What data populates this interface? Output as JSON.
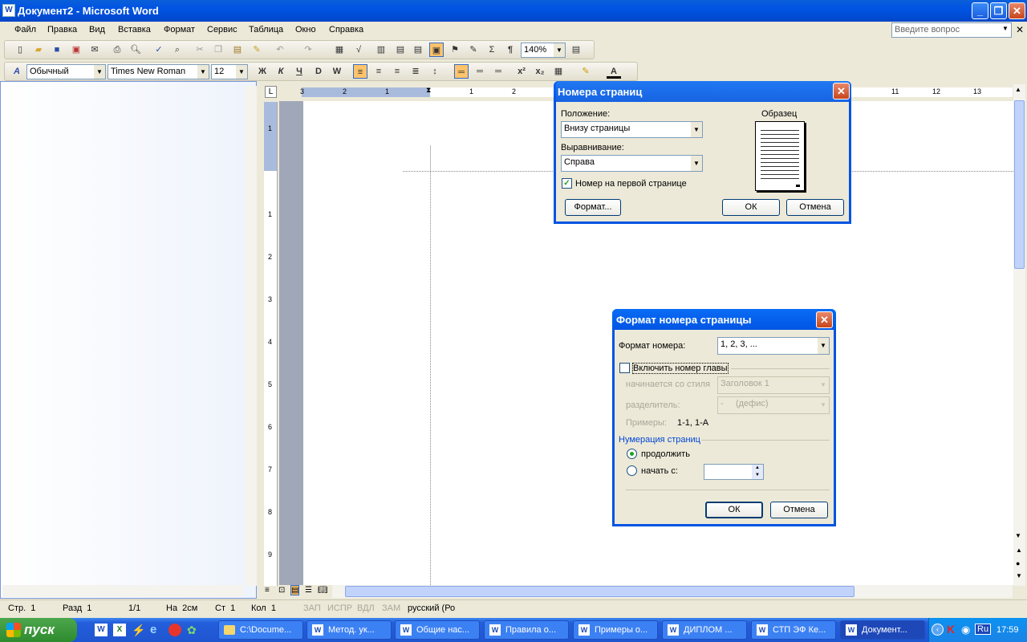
{
  "window": {
    "title": "Документ2 - Microsoft Word"
  },
  "menu": [
    "Файл",
    "Правка",
    "Вид",
    "Вставка",
    "Формат",
    "Сервис",
    "Таблица",
    "Окно",
    "Справка"
  ],
  "help_placeholder": "Введите вопрос",
  "toolbar": {
    "zoom": "140%"
  },
  "formatting": {
    "style": "Обычный",
    "font": "Times New Roman",
    "size": "12"
  },
  "ruler_numbers": [
    "3",
    "2",
    "1",
    "1",
    "2",
    "11",
    "12",
    "13"
  ],
  "vruler_numbers": [
    "1",
    "1",
    "2",
    "3",
    "4",
    "5",
    "6",
    "7",
    "8",
    "9"
  ],
  "page_numbers_dialog": {
    "title": "Номера страниц",
    "position_label": "Положение:",
    "position_value": "Внизу страницы",
    "alignment_label": "Выравнивание:",
    "alignment_value": "Справа",
    "first_page_label": "Номер на первой странице",
    "first_page_checked": true,
    "preview_label": "Образец",
    "format_button": "Формат...",
    "ok": "ОК",
    "cancel": "Отмена"
  },
  "format_dialog": {
    "title": "Формат номера страницы",
    "number_format_label": "Формат номера:",
    "number_format_value": "1, 2, 3, ...",
    "include_chapter_label": "Включить номер главы",
    "include_chapter_checked": false,
    "starts_with_label": "начинается со стиля",
    "starts_with_value": "Заголовок 1",
    "separator_label": "разделитель:",
    "separator_value": "-     (дефис)",
    "examples_label": "Примеры:",
    "examples_value": "1-1, 1-A",
    "numbering_group": "Нумерация страниц",
    "continue_label": "продолжить",
    "start_at_label": "начать с:",
    "continue_selected": true,
    "ok": "ОК",
    "cancel": "Отмена"
  },
  "status": {
    "page": "Стр.  1",
    "section": "Разд  1",
    "pages": "1/1",
    "at": "На  2см",
    "line": "Ст  1",
    "col": "Кол  1",
    "rec": "ЗАП",
    "trk": "ИСПР",
    "ext": "ВДЛ",
    "ovr": "ЗАМ",
    "lang": "русский (Ро"
  },
  "taskbar": {
    "start": "пуск",
    "tasks": [
      "C:\\Docume...",
      "Метод. ук...",
      "Общие нас...",
      "Правила о...",
      "Примеры о...",
      "ДИПЛОМ ...",
      "СТП ЭФ Ке...",
      "Документ..."
    ],
    "lang": "Ru",
    "clock": "17:59"
  },
  "colors": {
    "xp_blue": "#0054E3",
    "face": "#ECE9D8",
    "highlight": "#FFC36B"
  }
}
